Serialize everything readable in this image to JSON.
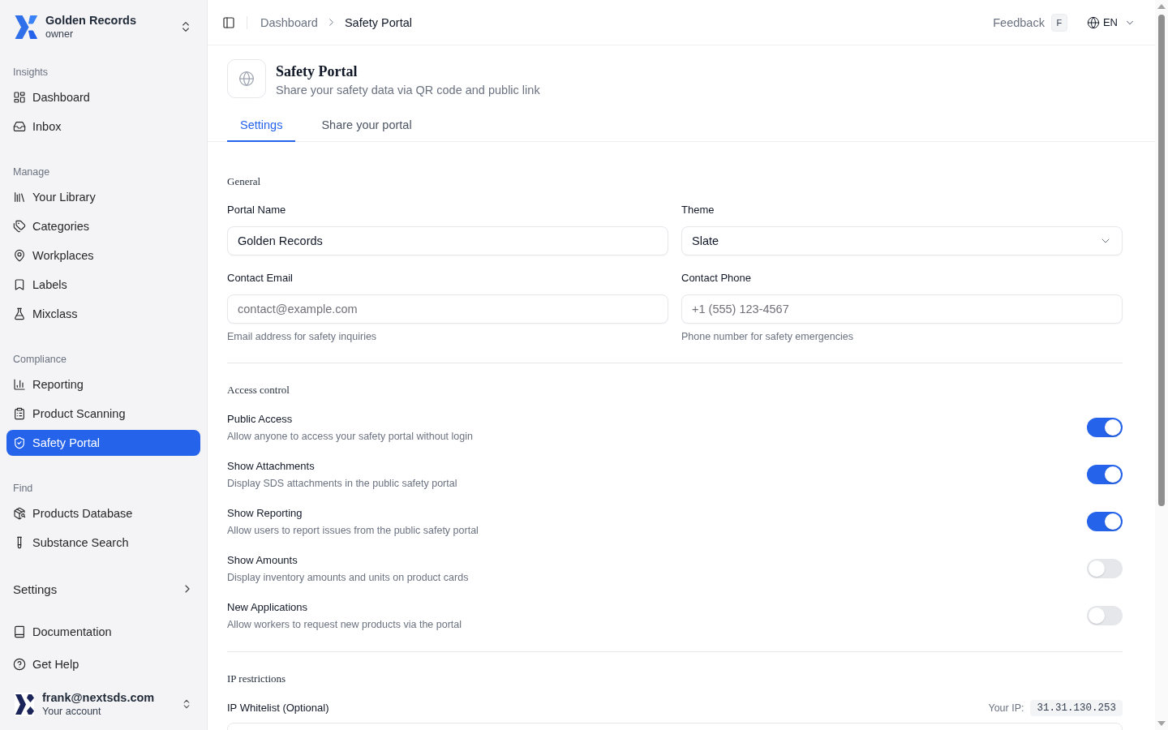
{
  "sidebar": {
    "workspace": {
      "name": "Golden Records",
      "role": "owner"
    },
    "groups": [
      {
        "label": "Insights",
        "items": [
          {
            "label": "Dashboard",
            "selected": false
          },
          {
            "label": "Inbox",
            "selected": false
          }
        ]
      },
      {
        "label": "Manage",
        "items": [
          {
            "label": "Your Library",
            "selected": false
          },
          {
            "label": "Categories",
            "selected": false
          },
          {
            "label": "Workplaces",
            "selected": false
          },
          {
            "label": "Labels",
            "selected": false
          },
          {
            "label": "Mixclass",
            "selected": false
          }
        ]
      },
      {
        "label": "Compliance",
        "items": [
          {
            "label": "Reporting",
            "selected": false
          },
          {
            "label": "Product Scanning",
            "selected": false
          },
          {
            "label": "Safety Portal",
            "selected": true
          }
        ]
      },
      {
        "label": "Find",
        "items": [
          {
            "label": "Products Database",
            "selected": false
          },
          {
            "label": "Substance Search",
            "selected": false
          }
        ]
      }
    ],
    "settings": {
      "label": "Settings",
      "expanded": false
    },
    "links": [
      {
        "label": "Documentation"
      },
      {
        "label": "Get Help"
      }
    ],
    "account": {
      "email": "frank@nextsds.com",
      "caption": "Your account"
    }
  },
  "header": {
    "breadcrumbs": [
      {
        "label": "Dashboard",
        "current": false
      },
      {
        "label": "Safety Portal",
        "current": true
      }
    ],
    "feedback": {
      "label": "Feedback",
      "shortcut": "F"
    },
    "language": "EN"
  },
  "page": {
    "title": "Safety Portal",
    "subtitle": "Share your safety data via QR code and public link",
    "tabs": [
      {
        "label": "Settings",
        "selected": true
      },
      {
        "label": "Share your portal",
        "selected": false
      }
    ]
  },
  "general": {
    "title": "General",
    "fields": [
      {
        "kind": "input",
        "label": "Portal Name",
        "value": "Golden Records"
      },
      {
        "kind": "select",
        "label": "Theme",
        "value": "Slate"
      },
      {
        "kind": "input",
        "label": "Contact Email",
        "placeholder": "contact@example.com",
        "help": "Email address for safety inquiries"
      },
      {
        "kind": "input",
        "label": "Contact Phone",
        "placeholder": "+1 (555) 123-4567",
        "help": "Phone number for safety emergencies"
      }
    ]
  },
  "access_control": {
    "title": "Access control",
    "toggles": [
      {
        "label": "Public Access",
        "description": "Allow anyone to access your safety portal without login",
        "on": true
      },
      {
        "label": "Show Attachments",
        "description": "Display SDS attachments in the public safety portal",
        "on": true
      },
      {
        "label": "Show Reporting",
        "description": "Allow users to report issues from the public safety portal",
        "on": true
      },
      {
        "label": "Show Amounts",
        "description": "Display inventory amounts and units on product cards",
        "on": false
      },
      {
        "label": "New Applications",
        "description": "Allow workers to request new products via the portal",
        "on": false
      }
    ]
  },
  "ip_restrictions": {
    "title": "IP restrictions",
    "label": "IP Whitelist (Optional)",
    "your_ip_label": "Your IP:",
    "your_ip": "31.31.130.253"
  }
}
